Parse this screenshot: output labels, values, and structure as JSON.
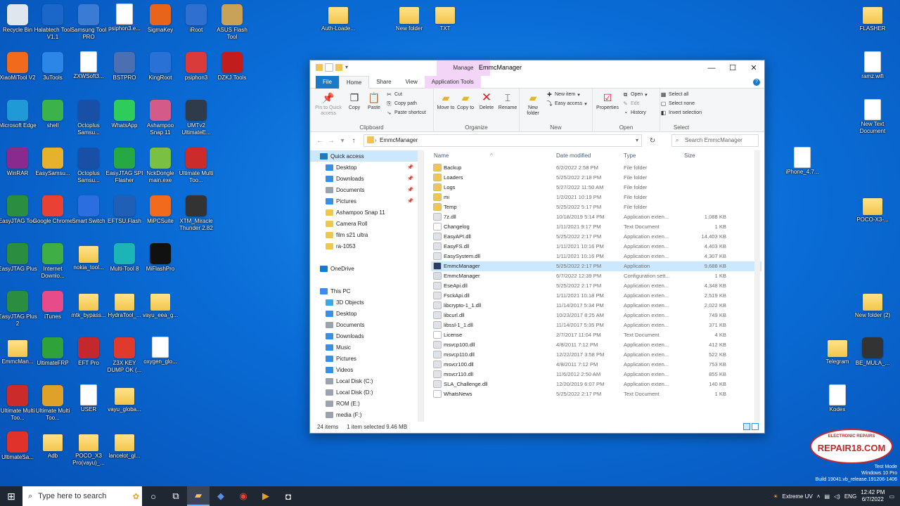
{
  "desktop": {
    "icons": [
      {
        "label": "Recycle Bin",
        "kind": "bin",
        "color": "#dfe6ee"
      },
      {
        "label": "Halabtech Tool V1.1",
        "kind": "app",
        "color": "#1a66c9"
      },
      {
        "label": "Samsung Tool PRO",
        "kind": "app",
        "color": "#3a7bd5"
      },
      {
        "label": "psiphon3.e...",
        "kind": "doc",
        "color": "#ffffff"
      },
      {
        "label": "SigmaKey",
        "kind": "app",
        "color": "#e8641b"
      },
      {
        "label": "iRoot",
        "kind": "app",
        "color": "#2f6fd0"
      },
      {
        "label": "ASUS Flash Tool",
        "kind": "app",
        "color": "#c9a25a"
      },
      {
        "label": "XiaoMiTool V2",
        "kind": "app",
        "color": "#f26b1d"
      },
      {
        "label": "3uTools",
        "kind": "app",
        "color": "#2c86e8"
      },
      {
        "label": "ZXWSoft3...",
        "kind": "doc",
        "color": "#ffffff"
      },
      {
        "label": "BSTPRO",
        "kind": "app",
        "color": "#4b6fb0"
      },
      {
        "label": "KingRoot",
        "kind": "app",
        "color": "#2a71d6"
      },
      {
        "label": "psiphon3",
        "kind": "app",
        "color": "#d93a3a"
      },
      {
        "label": "DZKJ Tools",
        "kind": "app",
        "color": "#c21d1d"
      },
      {
        "label": "Microsoft Edge",
        "kind": "app",
        "color": "#1f9ad6"
      },
      {
        "label": "shell",
        "kind": "app",
        "color": "#3cb34a"
      },
      {
        "label": "Octoplus Samsu...",
        "kind": "app",
        "color": "#1a4fa8"
      },
      {
        "label": "WhatsApp",
        "kind": "app",
        "color": "#2ecc5a"
      },
      {
        "label": "Ashampoo Snap 11",
        "kind": "app",
        "color": "#d45a8a"
      },
      {
        "label": "UMTv2 UltimateE...",
        "kind": "app",
        "color": "#2f3a4a"
      },
      {
        "label": "WinRAR",
        "kind": "app",
        "color": "#8a2a8f"
      },
      {
        "label": "EasySamsu...",
        "kind": "app",
        "color": "#e6b12c"
      },
      {
        "label": "Octoplus Samsu...",
        "kind": "app",
        "color": "#1a4fa8"
      },
      {
        "label": "EasyJTAG SPI Flasher",
        "kind": "app",
        "color": "#28a745"
      },
      {
        "label": "NckDongle main.exe",
        "kind": "app",
        "color": "#7ac043"
      },
      {
        "label": "Ultimate Multi Too...",
        "kind": "app",
        "color": "#cc2b2b"
      },
      {
        "label": "EasyJTAG Tool",
        "kind": "app",
        "color": "#2b8d3f"
      },
      {
        "label": "Google Chrome",
        "kind": "app",
        "color": "#e94235"
      },
      {
        "label": "Smart Switch",
        "kind": "app",
        "color": "#2a6ee0"
      },
      {
        "label": "EFTSU.Flash",
        "kind": "app",
        "color": "#1f5fb5"
      },
      {
        "label": "MiPCSuite",
        "kind": "app",
        "color": "#f26b1d"
      },
      {
        "label": "XTM_Miracle Thunder 2.82",
        "kind": "app",
        "color": "#333333"
      },
      {
        "label": "EasyJTAG Plus",
        "kind": "app",
        "color": "#2b8d3f"
      },
      {
        "label": "Internet Downlo...",
        "kind": "app",
        "color": "#3fae45"
      },
      {
        "label": "nokia_tool...",
        "kind": "folder",
        "color": "#f3c54c"
      },
      {
        "label": "Multi-Tool 8",
        "kind": "app",
        "color": "#1bb5b8"
      },
      {
        "label": "MiFlashPro",
        "kind": "app",
        "color": "#111111"
      },
      {
        "label": "EasyJTAG Plus 2",
        "kind": "app",
        "color": "#2b8d3f"
      },
      {
        "label": "iTunes",
        "kind": "app",
        "color": "#e84b8a"
      },
      {
        "label": "mtk_bypass...",
        "kind": "folder",
        "color": "#f3c54c"
      },
      {
        "label": "HydraTool_...",
        "kind": "folder",
        "color": "#f3c54c"
      },
      {
        "label": "vayu_eea_g...",
        "kind": "folder",
        "color": "#f3c54c"
      },
      {
        "label": "EmmcMan...",
        "kind": "folder",
        "color": "#f3c54c"
      },
      {
        "label": "UltimateFRP",
        "kind": "app",
        "color": "#2fa33a"
      },
      {
        "label": "EFT Pro",
        "kind": "app",
        "color": "#c4282d"
      },
      {
        "label": "Z3X KEY DUMP OK (...",
        "kind": "app",
        "color": "#e03a2d"
      },
      {
        "label": "oxygen_glo...",
        "kind": "doc",
        "color": "#ffffff"
      },
      {
        "label": "Ultimate Multi Too...",
        "kind": "app",
        "color": "#cc2b2b"
      },
      {
        "label": "Ultimate Multi Too...",
        "kind": "app",
        "color": "#e0a12b"
      },
      {
        "label": "USER",
        "kind": "doc",
        "color": "#ffffff"
      },
      {
        "label": "vayu_globa...",
        "kind": "folder",
        "color": "#f3c54c"
      },
      {
        "label": "UltimateSa...",
        "kind": "app",
        "color": "#e0312b"
      },
      {
        "label": "Adb",
        "kind": "folder",
        "color": "#f3c54c"
      },
      {
        "label": "POCO_X3 Pro(vayu)_...",
        "kind": "folder",
        "color": "#f3c54c"
      },
      {
        "label": "lancelot_gl...",
        "kind": "folder",
        "color": "#f3c54c"
      },
      {
        "label": "Auth-Loade...",
        "kind": "folder",
        "color": "#f3c54c"
      },
      {
        "label": "New folder",
        "kind": "folder",
        "color": "#f3c54c"
      },
      {
        "label": "TXT",
        "kind": "folder",
        "color": "#f3c54c"
      },
      {
        "label": "FLASHER",
        "kind": "folder",
        "color": "#f3c54c"
      },
      {
        "label": "ramz.wifi",
        "kind": "doc",
        "color": "#ffffff"
      },
      {
        "label": "New Text Document",
        "kind": "doc",
        "color": "#ffffff"
      },
      {
        "label": "iPhone_4.7...",
        "kind": "doc",
        "color": "#ffffff"
      },
      {
        "label": "POCO-X3-...",
        "kind": "folder",
        "color": "#f3c54c"
      },
      {
        "label": "New folder (2)",
        "kind": "folder",
        "color": "#f3c54c"
      },
      {
        "label": "Telegram",
        "kind": "folder",
        "color": "#f3c54c"
      },
      {
        "label": "BE_MULA_...",
        "kind": "app",
        "color": "#333333"
      },
      {
        "label": "Kodex",
        "kind": "doc",
        "color": "#ffffff"
      }
    ]
  },
  "explorer": {
    "window_title": "EmmcManager",
    "manage_tab": "Manage",
    "tabs": [
      "File",
      "Home",
      "Share",
      "View",
      "Application Tools"
    ],
    "ribbon": {
      "clipboard": {
        "pin": "Pin to Quick access",
        "copy": "Copy",
        "paste": "Paste",
        "cut": "Cut",
        "copy_path": "Copy path",
        "paste_shortcut": "Paste shortcut",
        "group": "Clipboard"
      },
      "organize": {
        "move_to": "Move to",
        "copy_to": "Copy to",
        "delete": "Delete",
        "rename": "Rename",
        "group": "Organize"
      },
      "new": {
        "new_folder": "New folder",
        "new_item": "New item",
        "easy_access": "Easy access",
        "group": "New"
      },
      "open": {
        "properties": "Properties",
        "open": "Open",
        "edit": "Edit",
        "history": "History",
        "group": "Open"
      },
      "select": {
        "select_all": "Select all",
        "select_none": "Select none",
        "invert": "Invert selection",
        "group": "Select"
      }
    },
    "address": "EmmcManager",
    "search_placeholder": "Search EmmcManager",
    "nav": [
      {
        "label": "Quick access",
        "icon": "star",
        "level": 0,
        "selected": true,
        "pinned": false
      },
      {
        "label": "Desktop",
        "icon": "desktop",
        "level": 1,
        "pinned": true
      },
      {
        "label": "Downloads",
        "icon": "download",
        "level": 1,
        "pinned": true
      },
      {
        "label": "Documents",
        "icon": "documents",
        "level": 1,
        "pinned": true
      },
      {
        "label": "Pictures",
        "icon": "pictures",
        "level": 1,
        "pinned": true
      },
      {
        "label": "Ashampoo Snap 11",
        "icon": "folder",
        "level": 1,
        "pinned": false
      },
      {
        "label": "Camera Roll",
        "icon": "folder",
        "level": 1,
        "pinned": false
      },
      {
        "label": "film s21 ultra",
        "icon": "folder",
        "level": 1,
        "pinned": false
      },
      {
        "label": "ra-1053",
        "icon": "folder",
        "level": 1,
        "pinned": false
      },
      {
        "label": "",
        "icon": "",
        "level": 0,
        "pinned": false
      },
      {
        "label": "OneDrive",
        "icon": "onedrive",
        "level": 0,
        "pinned": false
      },
      {
        "label": "",
        "icon": "",
        "level": 0,
        "pinned": false
      },
      {
        "label": "This PC",
        "icon": "pc",
        "level": 0,
        "pinned": false
      },
      {
        "label": "3D Objects",
        "icon": "objects",
        "level": 1,
        "pinned": false
      },
      {
        "label": "Desktop",
        "icon": "desktop",
        "level": 1,
        "pinned": false
      },
      {
        "label": "Documents",
        "icon": "documents",
        "level": 1,
        "pinned": false
      },
      {
        "label": "Downloads",
        "icon": "download",
        "level": 1,
        "pinned": false
      },
      {
        "label": "Music",
        "icon": "music",
        "level": 1,
        "pinned": false
      },
      {
        "label": "Pictures",
        "icon": "pictures",
        "level": 1,
        "pinned": false
      },
      {
        "label": "Videos",
        "icon": "videos",
        "level": 1,
        "pinned": false
      },
      {
        "label": "Local Disk (C:)",
        "icon": "drive",
        "level": 1,
        "pinned": false
      },
      {
        "label": "Local Disk (D:)",
        "icon": "drive",
        "level": 1,
        "pinned": false
      },
      {
        "label": "ROM (E:)",
        "icon": "drive",
        "level": 1,
        "pinned": false
      },
      {
        "label": "media (F:)",
        "icon": "drive",
        "level": 1,
        "pinned": false
      },
      {
        "label": "DUMP2 (G:)",
        "icon": "drive",
        "level": 1,
        "pinned": false
      }
    ],
    "columns": {
      "name": "Name",
      "date": "Date modified",
      "type": "Type",
      "size": "Size"
    },
    "files": [
      {
        "name": "Backup",
        "date": "6/2/2022 2:58 PM",
        "type": "File folder",
        "size": "",
        "icon": "folder"
      },
      {
        "name": "Loaders",
        "date": "5/25/2022 2:18 PM",
        "type": "File folder",
        "size": "",
        "icon": "folder"
      },
      {
        "name": "Logs",
        "date": "5/27/2022 11:50 AM",
        "type": "File folder",
        "size": "",
        "icon": "folder"
      },
      {
        "name": "mi",
        "date": "1/2/2021 10:19 PM",
        "type": "File folder",
        "size": "",
        "icon": "folder"
      },
      {
        "name": "Temp",
        "date": "5/25/2022 5:17 PM",
        "type": "File folder",
        "size": "",
        "icon": "folder"
      },
      {
        "name": "7z.dll",
        "date": "10/18/2019 5:14 PM",
        "type": "Application exten...",
        "size": "1,088 KB",
        "icon": "dll"
      },
      {
        "name": "Changelog",
        "date": "1/11/2021 9:17 PM",
        "type": "Text Document",
        "size": "1 KB",
        "icon": "txt"
      },
      {
        "name": "EasyAPI.dll",
        "date": "5/25/2022 2:17 PM",
        "type": "Application exten...",
        "size": "14,403 KB",
        "icon": "dll"
      },
      {
        "name": "EasyFS.dll",
        "date": "1/11/2021 10:16 PM",
        "type": "Application exten...",
        "size": "4,403 KB",
        "icon": "dll"
      },
      {
        "name": "EasySystem.dll",
        "date": "1/11/2021 10:16 PM",
        "type": "Application exten...",
        "size": "4,307 KB",
        "icon": "dll"
      },
      {
        "name": "EmmcManager",
        "date": "5/25/2022 2:17 PM",
        "type": "Application",
        "size": "9,688 KB",
        "icon": "exe",
        "selected": true
      },
      {
        "name": "EmmcManager",
        "date": "6/7/2022 12:39 PM",
        "type": "Configuration sett...",
        "size": "1 KB",
        "icon": "cfg"
      },
      {
        "name": "EseApi.dll",
        "date": "5/25/2022 2:17 PM",
        "type": "Application exten...",
        "size": "4,348 KB",
        "icon": "dll"
      },
      {
        "name": "FsckApi.dll",
        "date": "1/11/2021 10:18 PM",
        "type": "Application exten...",
        "size": "2,519 KB",
        "icon": "dll"
      },
      {
        "name": "libcrypto-1_1.dll",
        "date": "11/14/2017 5:34 PM",
        "type": "Application exten...",
        "size": "2,022 KB",
        "icon": "dll"
      },
      {
        "name": "libcurl.dll",
        "date": "10/23/2017 8:25 AM",
        "type": "Application exten...",
        "size": "749 KB",
        "icon": "dll"
      },
      {
        "name": "libssl-1_1.dll",
        "date": "11/14/2017 5:35 PM",
        "type": "Application exten...",
        "size": "371 KB",
        "icon": "dll"
      },
      {
        "name": "License",
        "date": "2/7/2017 11:04 PM",
        "type": "Text Document",
        "size": "4 KB",
        "icon": "txt"
      },
      {
        "name": "msvcp100.dll",
        "date": "4/8/2011 7:12 PM",
        "type": "Application exten...",
        "size": "412 KB",
        "icon": "dll"
      },
      {
        "name": "msvcp110.dll",
        "date": "12/22/2017 3:58 PM",
        "type": "Application exten...",
        "size": "522 KB",
        "icon": "dll"
      },
      {
        "name": "msvcr100.dll",
        "date": "4/8/2011 7:12 PM",
        "type": "Application exten...",
        "size": "753 KB",
        "icon": "dll"
      },
      {
        "name": "msvcr110.dll",
        "date": "11/6/2012 2:50 AM",
        "type": "Application exten...",
        "size": "855 KB",
        "icon": "dll"
      },
      {
        "name": "SLA_Challenge.dll",
        "date": "12/20/2019 6:07 PM",
        "type": "Application exten...",
        "size": "140 KB",
        "icon": "dll"
      },
      {
        "name": "WhatsNews",
        "date": "5/25/2022 2:17 PM",
        "type": "Text Document",
        "size": "1 KB",
        "icon": "txt"
      }
    ],
    "status": {
      "count": "24 items",
      "selection": "1 item selected  9.46 MB"
    }
  },
  "taskbar": {
    "search_placeholder": "Type here to search",
    "weather": "Extreme UV",
    "lang": "ENG",
    "time": "12:42 PM",
    "date": "6/7/2022"
  },
  "watermark": {
    "line1": "Test Mode",
    "line2": "Windows 10 Pro",
    "line3": "Build 19041.vb_release.191206-1406"
  },
  "logo": {
    "text": "REPAIR18.COM",
    "subtext": "ELECTRONIC REPAIRS"
  },
  "colors": {
    "accent": "#1979ca",
    "selection": "#cce8ff",
    "manage": "#f3d5f8",
    "desktop": "#0a6cd6"
  }
}
